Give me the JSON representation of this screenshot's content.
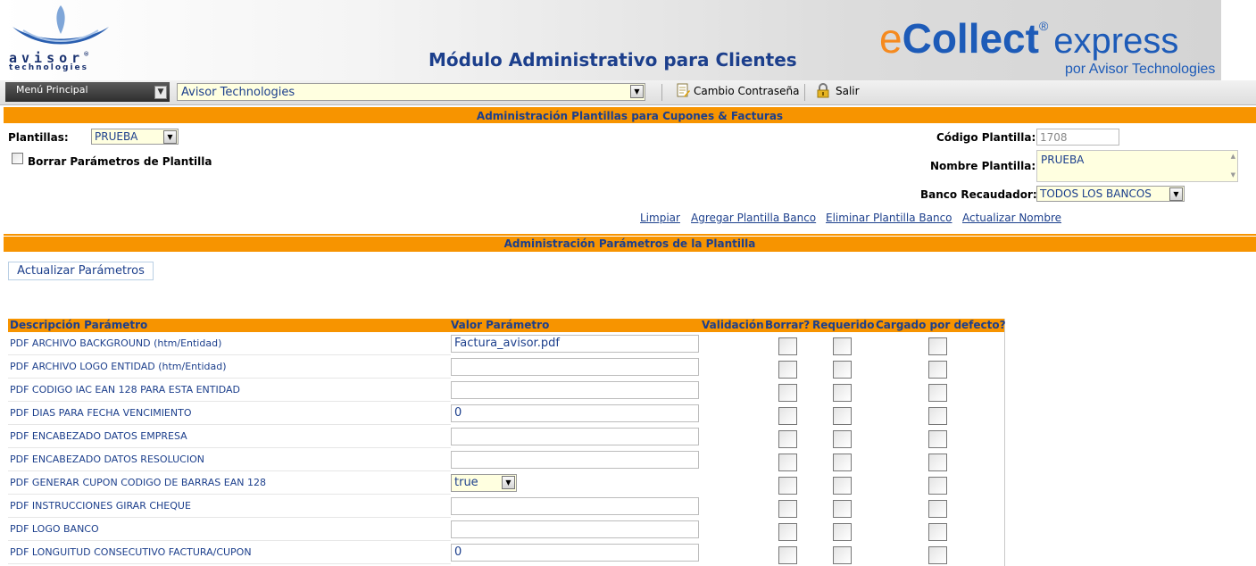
{
  "header": {
    "logo_word": "avisor",
    "logo_reg": "®",
    "logo_sub": "technologies",
    "module_title": "Módulo Administrativo para Clientes",
    "brand": {
      "e": "e",
      "collect": "Collect",
      "reg": "®",
      "express": "express",
      "tagline": "por Avisor Technologies"
    },
    "colors": {
      "brand_blue": "#1d5bb8",
      "brand_orange": "#f58a1f",
      "title_blue": "#1c3f8c"
    }
  },
  "menubar": {
    "main_menu_label": "Menú Principal",
    "client_selected": "Avisor Technologies",
    "change_password_label": "Cambio Contraseña",
    "change_password_icon": "document-edit-icon",
    "logout_label": "Salir",
    "logout_icon": "lock-icon"
  },
  "template_section": {
    "title": "Administración Plantillas para Cupones & Facturas",
    "plantillas_label": "Plantillas:",
    "plantillas_selected": "PRUEBA",
    "borrar_label": "Borrar Parámetros de Plantilla",
    "codigo_label": "Código Plantilla:",
    "codigo_value": "1708",
    "nombre_label": "Nombre Plantilla:",
    "nombre_value": "PRUEBA",
    "banco_label": "Banco Recaudador:",
    "banco_selected": "TODOS LOS BANCOS",
    "links": [
      "Limpiar",
      "Agregar Plantilla Banco",
      "Eliminar Plantilla Banco",
      "Actualizar Nombre"
    ]
  },
  "params_section": {
    "title": "Administración Parámetros de la Plantilla",
    "update_button": "Actualizar Parámetros",
    "columns": [
      "Descripción Parámetro",
      "Valor Parámetro",
      "Validación",
      "Borrar?",
      "Requerido",
      "Cargado por defecto?"
    ],
    "rows": [
      {
        "desc": "PDF ARCHIVO BACKGROUND (htm/Entidad)",
        "value": "Factura_avisor.pdf",
        "type": "text"
      },
      {
        "desc": "PDF ARCHIVO LOGO ENTIDAD (htm/Entidad)",
        "value": "",
        "type": "text"
      },
      {
        "desc": "PDF CODIGO IAC EAN 128 PARA ESTA ENTIDAD",
        "value": "",
        "type": "text"
      },
      {
        "desc": "PDF DIAS PARA FECHA VENCIMIENTO",
        "value": "0",
        "type": "text"
      },
      {
        "desc": "PDF ENCABEZADO DATOS EMPRESA",
        "value": "",
        "type": "text"
      },
      {
        "desc": "PDF ENCABEZADO DATOS RESOLUCION",
        "value": "",
        "type": "text"
      },
      {
        "desc": "PDF GENERAR CUPON CODIGO DE BARRAS EAN 128",
        "value": "true",
        "type": "select"
      },
      {
        "desc": "PDF INSTRUCCIONES GIRAR CHEQUE",
        "value": "",
        "type": "text"
      },
      {
        "desc": "PDF LOGO BANCO",
        "value": "",
        "type": "text"
      },
      {
        "desc": "PDF LONGUITUD CONSECUTIVO FACTURA/CUPON",
        "value": "0",
        "type": "text"
      }
    ]
  }
}
